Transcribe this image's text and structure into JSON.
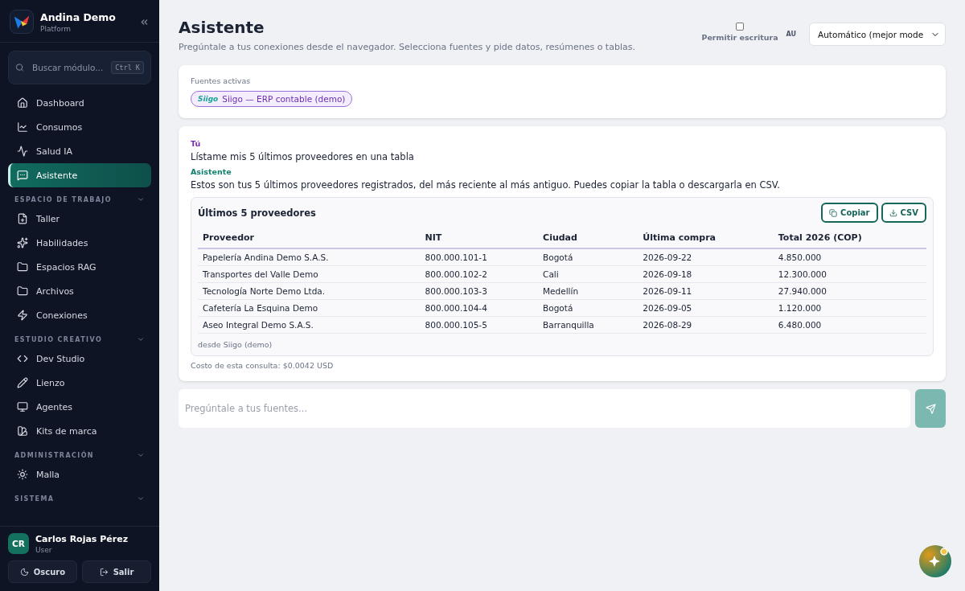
{
  "sidebar": {
    "brand": {
      "name": "Andina Demo",
      "subtitle": "Platform"
    },
    "search": {
      "placeholder": "Buscar módulo...",
      "shortcut": "Ctrl K"
    },
    "items": [
      {
        "label": "Dashboard",
        "selected": false
      },
      {
        "label": "Consumos",
        "selected": false
      },
      {
        "label": "Salud IA",
        "selected": false
      },
      {
        "label": "Asistente",
        "selected": true
      }
    ],
    "sections": [
      {
        "title": "ESPACIO DE TRABAJO",
        "expanded": true,
        "items": [
          {
            "label": "Taller",
            "selected": false
          },
          {
            "label": "Habilidades",
            "selected": false
          },
          {
            "label": "Espacios RAG",
            "selected": false
          },
          {
            "label": "Archivos",
            "selected": false
          },
          {
            "label": "Conexiones",
            "selected": false
          }
        ]
      },
      {
        "title": "ESTUDIO CREATIVO",
        "expanded": true,
        "items": [
          {
            "label": "Dev Studio",
            "selected": false
          },
          {
            "label": "Lienzo",
            "selected": false
          },
          {
            "label": "Agentes",
            "selected": false
          },
          {
            "label": "Kits de marca",
            "selected": false
          }
        ]
      },
      {
        "title": "ADMINISTRACIÓN",
        "expanded": true,
        "items": [
          {
            "label": "Malla",
            "selected": false
          }
        ]
      },
      {
        "title": "SISTEMA",
        "expanded": true
      }
    ],
    "user": {
      "initials": "CR",
      "name": "Carlos Rojas Pérez",
      "role": "User"
    },
    "buttons": [
      {
        "label": "Oscuro"
      },
      {
        "label": "Salir"
      }
    ]
  },
  "header": {
    "title": "Asistente",
    "subtitle": "Pregúntale a tus conexiones desde el navegador. Selecciona fuentes y pide datos, resúmenes o tablas.",
    "write_permission": {
      "label": "Permitir escritura",
      "checked": false
    },
    "model_badge": "AU",
    "model_select": "Automático (mejor mode"
  },
  "sources": {
    "label": "Fuentes activas",
    "chips": [
      {
        "logo": "Siigo",
        "label": "Siigo — ERP contable (demo)"
      }
    ]
  },
  "conversation": {
    "messages": [
      {
        "kind": "user",
        "author": "Tú",
        "text": "Lístame mis 5 últimos proveedores en una tabla"
      },
      {
        "kind": "assistant",
        "author": "Asistente",
        "text": "Estos son tus 5 últimos proveedores registrados, del más reciente al más antiguo. Puedes copiar la tabla o descargarla en CSV."
      }
    ],
    "table": {
      "title": "Últimos 5 proveedores",
      "buttons": [
        "Copiar",
        "CSV"
      ],
      "columns": [
        "Proveedor",
        "NIT",
        "Ciudad",
        "Última compra",
        "Total 2026 (COP)"
      ],
      "rows": [
        [
          "Papelería Andina Demo S.A.S.",
          "800.000.101-1",
          "Bogotá",
          "2026-09-22",
          "4.850.000"
        ],
        [
          "Transportes del Valle Demo",
          "800.000.102-2",
          "Cali",
          "2026-09-18",
          "12.300.000"
        ],
        [
          "Tecnología Norte Demo Ltda.",
          "800.000.103-3",
          "Medellín",
          "2026-09-11",
          "27.940.000"
        ],
        [
          "Cafetería La Esquina Demo",
          "800.000.104-4",
          "Bogotá",
          "2026-09-05",
          "1.120.000"
        ],
        [
          "Aseo Integral Demo S.A.S.",
          "800.000.105-5",
          "Barranquilla",
          "2026-08-29",
          "6.480.000"
        ]
      ],
      "footnote": "desde Siigo (demo)"
    },
    "cost": "Costo de esta consulta: $0.0042 USD"
  },
  "composer": {
    "placeholder": "Pregúntale a tus fuentes..."
  }
}
